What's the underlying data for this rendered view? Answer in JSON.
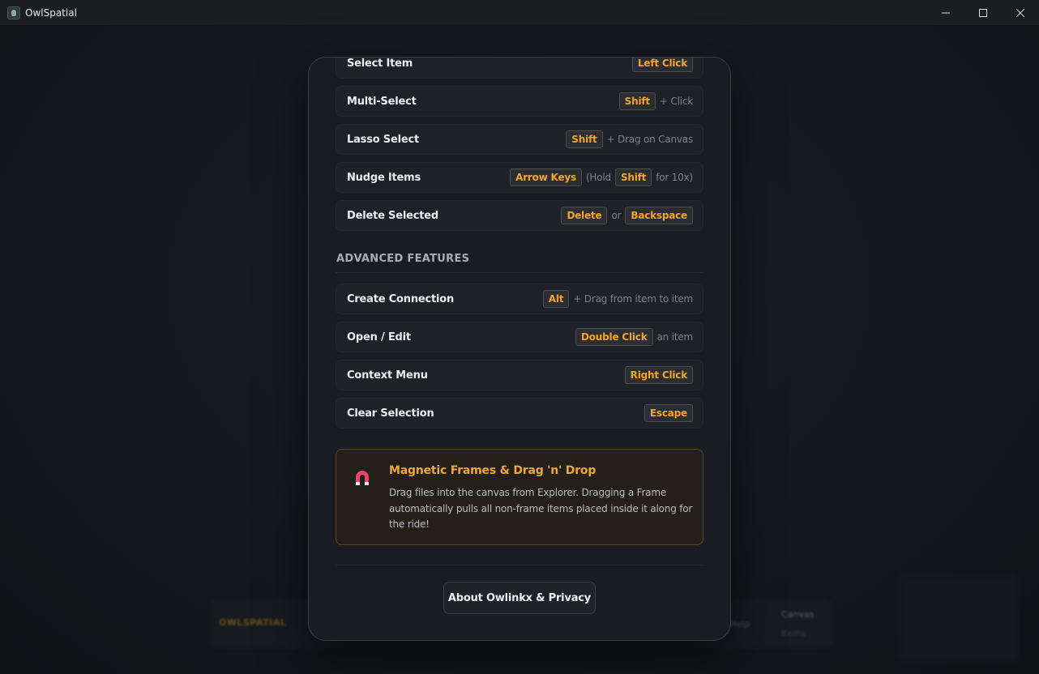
{
  "window": {
    "title": "OwlSpatial",
    "controls": {
      "minimize": "—",
      "maximize": "☐",
      "close": "✕"
    }
  },
  "background": {
    "brand": "OWLSPATIAL",
    "text_a": "Canvas",
    "text_b": "Items",
    "text_c": "Help"
  },
  "shortcuts": {
    "basic": [
      {
        "label": "Select Item",
        "keys": [
          {
            "type": "kbd",
            "text": "Left Click"
          }
        ]
      },
      {
        "label": "Multi-Select",
        "keys": [
          {
            "type": "kbd",
            "text": "Shift"
          },
          {
            "type": "text",
            "text": "+ Click"
          }
        ]
      },
      {
        "label": "Lasso Select",
        "keys": [
          {
            "type": "kbd",
            "text": "Shift"
          },
          {
            "type": "text",
            "text": "+ Drag on Canvas"
          }
        ]
      },
      {
        "label": "Nudge Items",
        "keys": [
          {
            "type": "kbd",
            "text": "Arrow Keys"
          },
          {
            "type": "text",
            "text": "(Hold"
          },
          {
            "type": "kbd",
            "text": "Shift"
          },
          {
            "type": "text",
            "text": "for 10x)"
          }
        ]
      },
      {
        "label": "Delete Selected",
        "keys": [
          {
            "type": "kbd",
            "text": "Delete"
          },
          {
            "type": "text",
            "text": "or"
          },
          {
            "type": "kbd",
            "text": "Backspace"
          }
        ]
      }
    ],
    "advanced_title": "ADVANCED FEATURES",
    "advanced": [
      {
        "label": "Create Connection",
        "keys": [
          {
            "type": "kbd",
            "text": "Alt"
          },
          {
            "type": "text",
            "text": "+ Drag from item to item"
          }
        ]
      },
      {
        "label": "Open / Edit",
        "keys": [
          {
            "type": "kbd",
            "text": "Double Click"
          },
          {
            "type": "text",
            "text": "an item"
          }
        ]
      },
      {
        "label": "Context Menu",
        "keys": [
          {
            "type": "kbd",
            "text": "Right Click"
          }
        ]
      },
      {
        "label": "Clear Selection",
        "keys": [
          {
            "type": "kbd",
            "text": "Escape"
          }
        ]
      }
    ]
  },
  "tip": {
    "icon": "magnet-icon",
    "title": "Magnetic Frames & Drag 'n' Drop",
    "body": "Drag files into the canvas from Explorer. Dragging a Frame automatically pulls all non-frame items placed inside it along for the ride!"
  },
  "footer": {
    "about_label": "About Owlinkx & Privacy"
  },
  "colors": {
    "accent": "#f0a62a",
    "tip_border": "#5a4624",
    "magnet_red": "#e8456b"
  }
}
